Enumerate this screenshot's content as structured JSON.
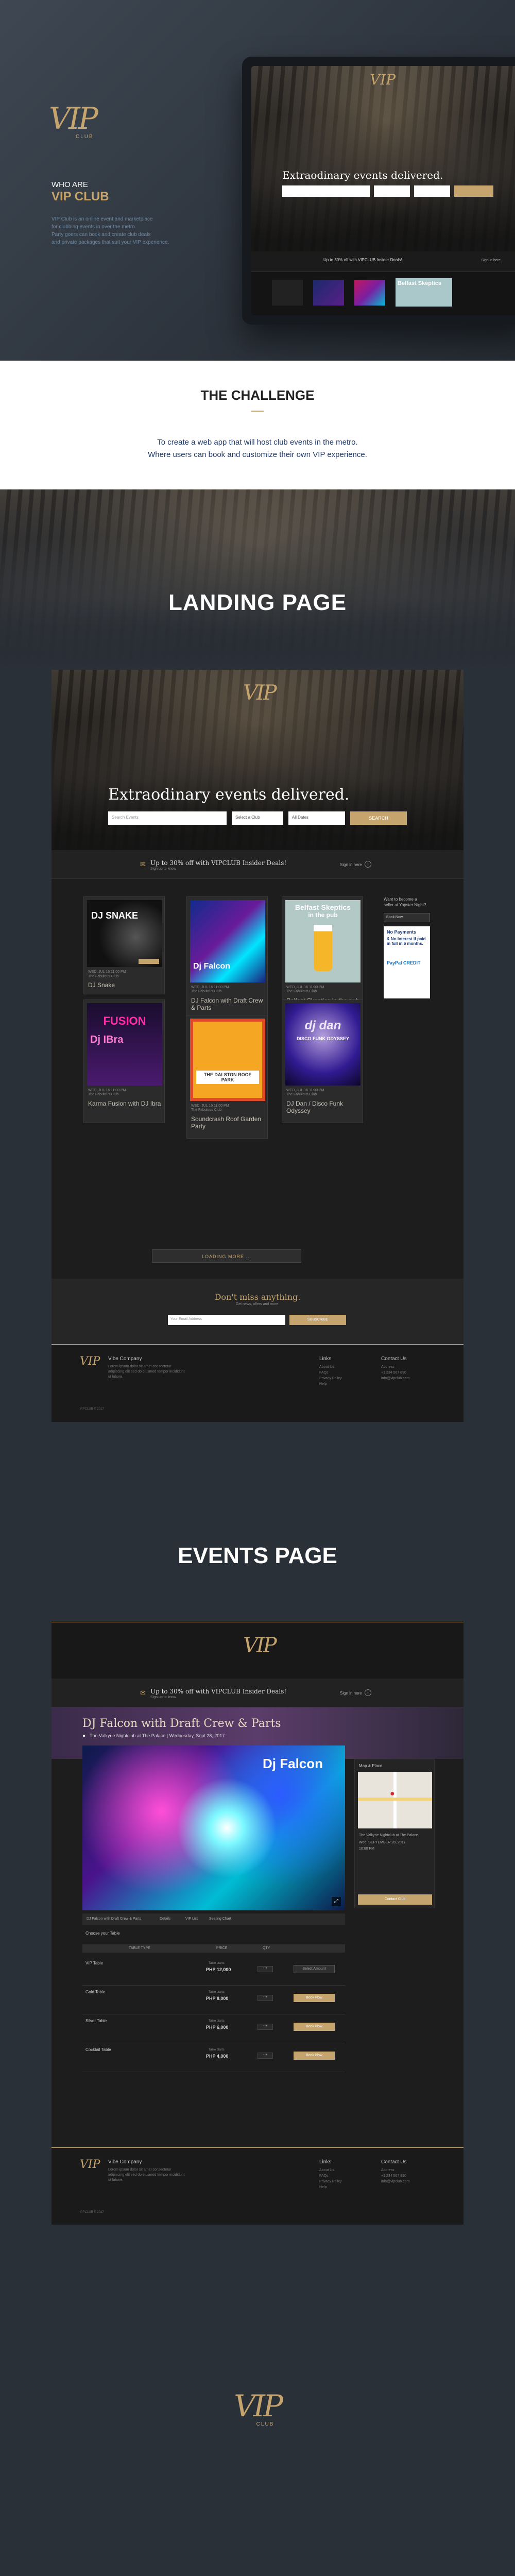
{
  "colors": {
    "accent": "#c5a46d",
    "dark_bg": "#2a3038",
    "mock_bg": "#1d1d1d"
  },
  "hero": {
    "logo": "VIP",
    "logo_sub": "CLUB",
    "who_are": "WHO ARE",
    "vip_club": "VIP CLUB",
    "desc_line1": "VIP Club is an online event and marketplace",
    "desc_line2": "for clubbing events in over the metro.",
    "desc_line3": "Party goers can book and create club deals",
    "desc_line4": "and private packages that suit your VIP experience."
  },
  "challenge": {
    "title": "THE CHALLENGE",
    "line1": "To create a web app that will host club events in the metro.",
    "line2": "Where users can book and customize their own VIP experience."
  },
  "landing": {
    "section_title": "LANDING PAGE",
    "tagline": "Extraodinary events delivered.",
    "search_placeholder": "Search Events",
    "select_club": "Select a Club",
    "all_dates": "All Dates",
    "search_button": "SEARCH",
    "promo": "Up to 30% off with VIPCLUB Insider Deals!",
    "promo_sub": "Sign up to know",
    "signin": "Sign in here",
    "cards": [
      {
        "meta": "WED, JUL 16 11:00 PM",
        "venue": "The Fabulous Club",
        "title": "DJ Snake"
      },
      {
        "meta": "WED, JUL 16 11:00 PM",
        "venue": "The Fabulous Club",
        "title": "DJ Falcon with Draft Crew & Parts"
      },
      {
        "meta": "WED, JUL 16 11:00 PM",
        "venue": "The Fabulous Club",
        "title": "Belfast Skeptics in the pub"
      },
      {
        "meta": "WED, JUL 16 11:00 PM",
        "venue": "The Fabulous Club",
        "title": "Karma Fusion with DJ Ibra"
      },
      {
        "meta": "WED, JUL 16 11:00 PM",
        "venue": "The Fabulous Club",
        "title": "Soundcrash Roof Garden Party"
      },
      {
        "meta": "WED, JUL 16 11:00 PM",
        "venue": "The Fabulous Club",
        "title": "DJ Dan / Disco Funk Odyssey"
      }
    ],
    "sidebar_title": "Want to become a seller at Yapster Night?",
    "sidebar_btn": "Book Now",
    "ad_text1": "No Payments",
    "ad_text2": "& No Interest if paid in full in 6 months.",
    "ad_text3": "PayPal CREDIT",
    "loading": "LOADING MORE ...",
    "newsletter_title": "Don't miss anything.",
    "newsletter_sub": "Get news, offers and more.",
    "newsletter_placeholder": "Your Email Address",
    "newsletter_btn": "SUBSCRIBE",
    "posters": {
      "snake_name": "DJ SNAKE",
      "falcon_name": "Dj Falcon",
      "belfast_title": "Belfast Skeptics",
      "belfast_sub": "in the pub",
      "fusion_title": "FUSION",
      "ibra": "Dj IBra",
      "dan": "dj dan",
      "disco": "DISCO FUNK ODYSSEY",
      "soundcrash": "THE DALSTON ROOF PARK",
      "coast": "COAST"
    }
  },
  "footer": {
    "company_title": "Vibe Company",
    "company_text": "Lorem ipsum dolor sit amet consectetur adipiscing elit sed do eiusmod tempor incididunt ut labore.",
    "links_title": "Links",
    "links": [
      "About Us",
      "FAQs",
      "Privacy Policy",
      "Help"
    ],
    "contact_title": "Contact Us",
    "contact": [
      "Address",
      "+1 234 567 890",
      "info@vipclub.com"
    ],
    "copyright": "VIPCLUB © 2017"
  },
  "events": {
    "section_title": "EVENTS PAGE",
    "promo": "Up to 30% off with VIPCLUB Insider Deals!",
    "promo_sub": "Sign up to know",
    "signin": "Sign in here",
    "event_title": "DJ Falcon with Draft Crew & Parts",
    "event_sub": "The Valkyrie Nightclub at The Palace | Wednesday, Sept 28, 2017",
    "map_title": "Map & Place",
    "map_address": "The Valkyrie Nightclub at The Palace",
    "map_date": "Wed, SEPTEMBER 28, 2017",
    "map_time": "10:00 PM",
    "map_btn": "Contact Club",
    "tabs": [
      "DJ Falcon with Draft Crew & Parts",
      "Details",
      "VIP List",
      "Seating Chart"
    ],
    "desc_title": "Choose your Table",
    "table_header": [
      "TABLE TYPE",
      "PRICE",
      "QTY"
    ],
    "rows": [
      {
        "name": "VIP Table",
        "price": "PHP 12,000",
        "btn": "Select Amount",
        "active": false
      },
      {
        "name": "Gold Table",
        "price": "PHP 8,000",
        "btn": "Book Now",
        "active": true
      },
      {
        "name": "Silver Table",
        "price": "PHP 6,000",
        "btn": "Book Now",
        "active": true
      },
      {
        "name": "Cocktail Table",
        "price": "PHP 4,000",
        "btn": "Book Now",
        "active": true
      }
    ],
    "price_label": "Table starts",
    "falcon_poster_name": "Dj Falcon"
  },
  "bottom_logo": "VIP",
  "bottom_logo_sub": "CLUB"
}
